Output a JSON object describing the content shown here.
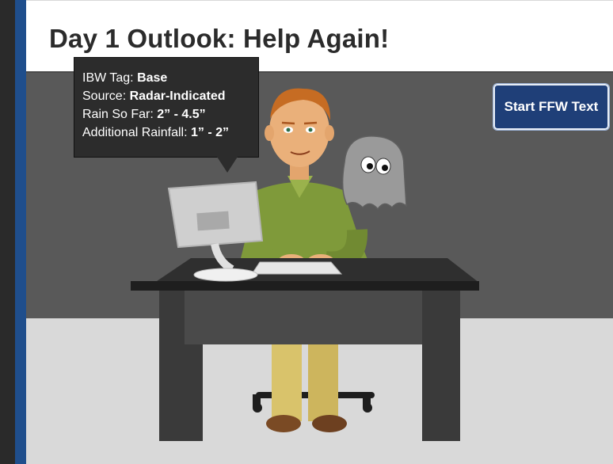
{
  "slide": {
    "title": "Day 1 Outlook: Help Again!"
  },
  "tooltip": {
    "rows": [
      {
        "label": "IBW Tag: ",
        "value": "Base"
      },
      {
        "label": "Source: ",
        "value": "Radar-Indicated"
      },
      {
        "label": "Rain So Far: ",
        "value": "2” - 4.5”"
      },
      {
        "label": "Additional Rainfall: ",
        "value": "1” - 2”"
      }
    ]
  },
  "buttons": {
    "start_ffw_text": "Start FFW Text"
  },
  "colors": {
    "accent_blue": "#1f4e8c",
    "button_blue": "#1f3f78",
    "wall_gray": "#595959",
    "floor_gray": "#d9d9d9"
  },
  "illustration": {
    "character": "man-at-desk",
    "ghost": "ghost-icon",
    "computer": "monitor-and-keyboard"
  }
}
